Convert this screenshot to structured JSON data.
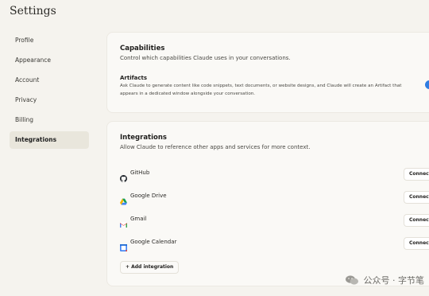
{
  "page": {
    "title": "Settings"
  },
  "sidebar": {
    "items": [
      {
        "label": "Profile"
      },
      {
        "label": "Appearance"
      },
      {
        "label": "Account"
      },
      {
        "label": "Privacy"
      },
      {
        "label": "Billing"
      },
      {
        "label": "Integrations",
        "active": true
      }
    ]
  },
  "capabilities": {
    "title": "Capabilities",
    "subtitle": "Control which capabilities Claude uses in your conversations.",
    "artifacts": {
      "title": "Artifacts",
      "description": "Ask Claude to generate content like code snippets, text documents, or website designs, and Claude will create an Artifact that appears in a dedicated window alongside your conversation.",
      "enabled": true
    }
  },
  "integrations": {
    "title": "Integrations",
    "subtitle": "Allow Claude to reference other apps and services for more context.",
    "items": [
      {
        "name": "GitHub",
        "icon": "github-icon",
        "action": "Connect"
      },
      {
        "name": "Google Drive",
        "icon": "google-drive-icon",
        "action": "Connect"
      },
      {
        "name": "Gmail",
        "icon": "gmail-icon",
        "action": "Connect"
      },
      {
        "name": "Google Calendar",
        "icon": "google-calendar-icon",
        "action": "Connect"
      }
    ],
    "add_label": "+ Add integration"
  },
  "watermark": {
    "text": "公众号 · 字节笔"
  },
  "colors": {
    "accent": "#2f7de1",
    "background": "#f5f3ee",
    "active_nav": "#e9e6dc"
  }
}
